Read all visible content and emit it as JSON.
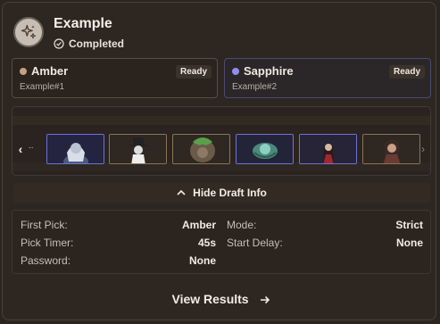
{
  "header": {
    "title": "Example",
    "status": "Completed",
    "icon": "sparkles-icon"
  },
  "teams": [
    {
      "name": "Amber",
      "tag": "Example#1",
      "status": "Ready",
      "color": "#c8a080"
    },
    {
      "name": "Sapphire",
      "tag": "Example#2",
      "status": "Ready",
      "color": "#8e8ef0"
    }
  ],
  "picks": {
    "nav_dots": "..",
    "portraits": [
      {
        "name": "portrait-1",
        "team": "Sapphire"
      },
      {
        "name": "portrait-2",
        "team": "Amber"
      },
      {
        "name": "portrait-3",
        "team": "Amber"
      },
      {
        "name": "portrait-4",
        "team": "Sapphire"
      },
      {
        "name": "portrait-5",
        "team": "Sapphire"
      },
      {
        "name": "portrait-6",
        "team": "Amber"
      }
    ]
  },
  "draft_toggle": {
    "label": "Hide Draft Info"
  },
  "draft_info": {
    "first_pick_label": "First Pick:",
    "first_pick": "Amber",
    "pick_timer_label": "Pick Timer:",
    "pick_timer": "45s",
    "password_label": "Password:",
    "password": "None",
    "mode_label": "Mode:",
    "mode": "Strict",
    "start_delay_label": "Start Delay:",
    "start_delay": "None"
  },
  "footer": {
    "view_results": "View Results"
  },
  "colors": {
    "accent_blue": "#6e73d8",
    "accent_amber": "#8a7459"
  }
}
